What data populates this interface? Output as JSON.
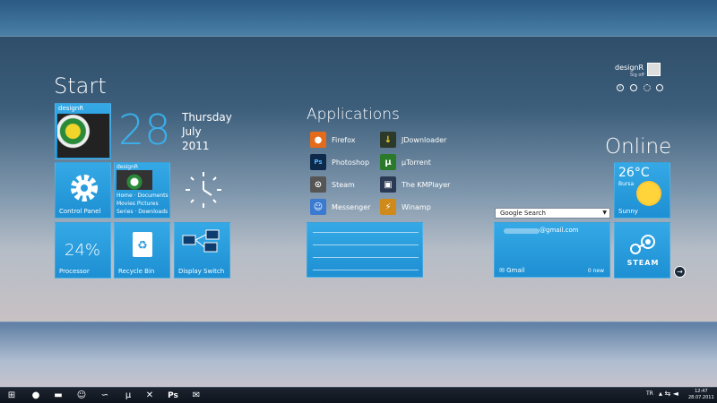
{
  "start": {
    "title": "Start"
  },
  "profile": {
    "name": "designR",
    "signout": "Sig off"
  },
  "date": {
    "day": "28",
    "weekday": "Thursday",
    "month": "July",
    "year": "2011"
  },
  "tiles": {
    "user": {
      "label": "designR"
    },
    "control_panel": {
      "label": "Control Panel"
    },
    "libraries": {
      "title": "designR",
      "items": [
        "Home",
        "Documents",
        "Movies",
        "Pictures",
        "Series",
        "Downloads"
      ]
    },
    "processor": {
      "value": "24%",
      "label": "Processor"
    },
    "recycle": {
      "label": "Recycle Bin"
    },
    "display": {
      "label": "Display Switch"
    }
  },
  "applications": {
    "title": "Applications",
    "items": [
      {
        "label": "Firefox",
        "icon": "firefox-icon"
      },
      {
        "label": "JDownloader",
        "icon": "jdownloader-icon"
      },
      {
        "label": "Photoshop",
        "icon": "photoshop-icon"
      },
      {
        "label": "µTorrent",
        "icon": "utorrent-icon"
      },
      {
        "label": "Steam",
        "icon": "steam-icon"
      },
      {
        "label": "The KMPlayer",
        "icon": "kmplayer-icon"
      },
      {
        "label": "Messenger",
        "icon": "messenger-icon"
      },
      {
        "label": "Winamp",
        "icon": "winamp-icon"
      }
    ]
  },
  "online": {
    "title": "Online",
    "weather": {
      "temp": "26°C",
      "city": "Bursa",
      "condition": "Sunny"
    },
    "search": {
      "label": "Google Search"
    },
    "gmail": {
      "address": "@gmail.com",
      "label": "Gmail",
      "count": "0 new"
    },
    "steam": {
      "label": "STEAM"
    }
  },
  "taskbar": {
    "lang": "TR",
    "time": "12:47",
    "date": "28.07.2011"
  },
  "colors": {
    "tile": "#2a9bdc",
    "taskbar": "#121a24"
  }
}
